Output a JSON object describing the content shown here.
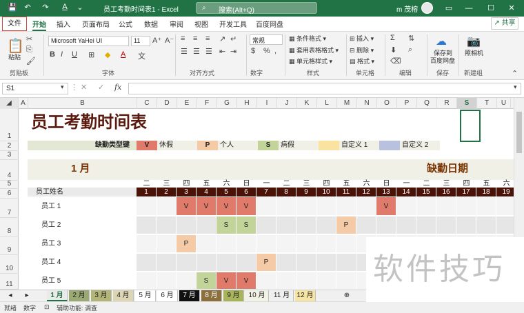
{
  "window": {
    "title": "员工考勤时间表1 - Excel",
    "search_placeholder": "搜索(Alt+Q)",
    "user_name": "m 茂榕"
  },
  "ribbon_tabs": [
    "文件",
    "开始",
    "插入",
    "页面布局",
    "公式",
    "数据",
    "审阅",
    "视图",
    "开发工具",
    "百度网盘"
  ],
  "share_label": "共享",
  "ribbon": {
    "clipboard": {
      "paste": "粘贴",
      "group": "剪贴板"
    },
    "font": {
      "family": "Microsoft YaHei UI",
      "size": "11",
      "group": "字体"
    },
    "alignment": {
      "group": "对齐方式"
    },
    "number": {
      "format": "常规",
      "group": "数字"
    },
    "styles": {
      "cond": "条件格式",
      "table": "套用表格格式",
      "cell": "单元格样式",
      "group": "样式"
    },
    "cells": {
      "insert": "插入",
      "delete": "删除",
      "format": "格式",
      "group": "单元格"
    },
    "editing": {
      "group": "编辑"
    },
    "save": {
      "label1": "保存到",
      "label2": "百度网盘",
      "group": "保存"
    },
    "newgroup": {
      "label": "照相机",
      "group": "新建组"
    }
  },
  "formula_bar": {
    "name_box": "S1",
    "fx": "fx",
    "value": ""
  },
  "columns": [
    "A",
    "B",
    "C",
    "D",
    "E",
    "F",
    "G",
    "H",
    "I",
    "J",
    "K",
    "L",
    "M",
    "N",
    "O",
    "P",
    "Q",
    "R",
    "S",
    "T",
    "U"
  ],
  "rows": [
    "1",
    "2",
    "3",
    "4",
    "5",
    "6",
    "7",
    "8",
    "9",
    "10",
    "11"
  ],
  "sheet": {
    "title": "员工考勤时间表",
    "legend_label": "缺勤类型键",
    "legend": [
      {
        "key": "V",
        "label": "休假",
        "color": "#e07a6a"
      },
      {
        "key": "P",
        "label": "个人",
        "color": "#f5cba7"
      },
      {
        "key": "S",
        "label": "病假",
        "color": "#c3d49b"
      },
      {
        "key": "",
        "label": "自定义 1",
        "color": "#fae2a1"
      },
      {
        "key": "",
        "label": "自定义 2",
        "color": "#b8c2de"
      }
    ],
    "month": "1 月",
    "absence_title": "缺勤日期",
    "name_header": "员工姓名",
    "weekdays": [
      "二",
      "三",
      "四",
      "五",
      "六",
      "日",
      "一",
      "二",
      "三",
      "四",
      "五",
      "六",
      "日",
      "一",
      "二",
      "三",
      "四",
      "五",
      "六"
    ],
    "days": [
      "1",
      "2",
      "3",
      "4",
      "5",
      "6",
      "7",
      "8",
      "9",
      "10",
      "11",
      "12",
      "13",
      "14",
      "15",
      "16",
      "17",
      "18",
      "19"
    ],
    "employees": [
      {
        "name": "员工 1",
        "marks": [
          "",
          "",
          "V",
          "V",
          "V",
          "V",
          "",
          "",
          "",
          "",
          "",
          "",
          "V",
          "",
          "",
          "",
          "",
          "",
          ""
        ]
      },
      {
        "name": "员工 2",
        "marks": [
          "",
          "",
          "",
          "",
          "S",
          "S",
          "",
          "",
          "",
          "",
          "P",
          "",
          "",
          "",
          "",
          "",
          "",
          "",
          ""
        ]
      },
      {
        "name": "员工 3",
        "marks": [
          "",
          "",
          "P",
          "",
          "",
          "",
          "",
          "",
          "",
          "",
          "",
          "",
          "",
          "",
          "",
          "",
          "",
          "",
          ""
        ]
      },
      {
        "name": "员工 4",
        "marks": [
          "",
          "",
          "",
          "",
          "",
          "",
          "P",
          "",
          "",
          "",
          "",
          "",
          "",
          "",
          "",
          "",
          "",
          "",
          ""
        ]
      },
      {
        "name": "员工 5",
        "marks": [
          "",
          "",
          "",
          "S",
          "V",
          "V",
          "",
          "",
          "",
          "",
          "",
          "",
          "",
          "",
          "",
          "",
          "",
          "",
          ""
        ]
      }
    ]
  },
  "sheet_tabs": [
    {
      "label": "1 月",
      "active": true,
      "color": "#eaeaea"
    },
    {
      "label": "2 月",
      "color": "#9aa873"
    },
    {
      "label": "3 月",
      "color": "#b3b578"
    },
    {
      "label": "4 月",
      "color": "#dcd6b4"
    },
    {
      "label": "5 月",
      "color": "#ffffff"
    },
    {
      "label": "6 月",
      "color": "#ffffff"
    },
    {
      "label": "7 月",
      "color": "#111111"
    },
    {
      "label": "8 月",
      "color": "#8b6f3d"
    },
    {
      "label": "9 月",
      "color": "#a8b45c"
    },
    {
      "label": "10 月",
      "color": "#f1f1e6"
    },
    {
      "label": "11 月",
      "color": "#efefef"
    },
    {
      "label": "12 月",
      "color": "#f5e4a3"
    }
  ],
  "status": {
    "ready": "就绪",
    "mode": "数字",
    "accessibility": "辅助功能: 调查"
  },
  "watermark": "软件技巧"
}
